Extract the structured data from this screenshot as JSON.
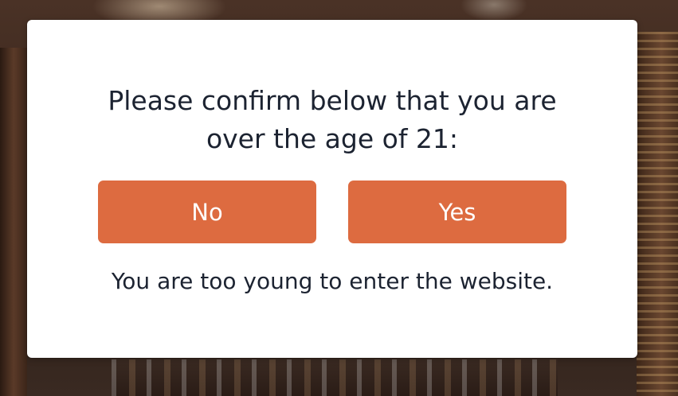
{
  "age_gate": {
    "prompt_line1": "Please confirm below that you are",
    "prompt_line2": "over the age of 21:",
    "no_label": "No",
    "yes_label": "Yes",
    "message": "You are too young to enter the website."
  },
  "colors": {
    "button_bg": "#dd6b40",
    "button_text": "#ffffff",
    "text": "#1c2331",
    "modal_bg": "#ffffff"
  }
}
